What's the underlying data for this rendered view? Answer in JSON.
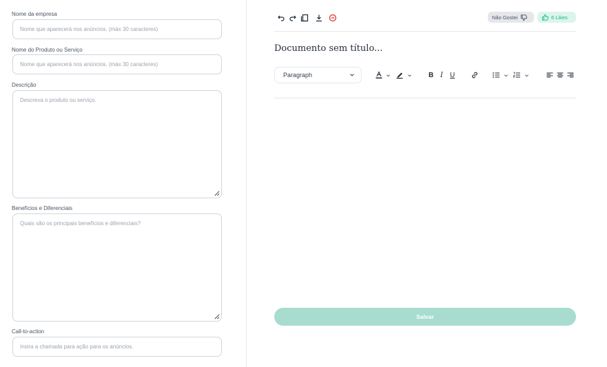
{
  "form": {
    "company_name": {
      "label": "Nome da empresa",
      "placeholder": "Nome que aparecerá nos anúncios. (máx 30 caracteres)"
    },
    "product_name": {
      "label": "Nome do Produto ou Serviço",
      "placeholder": "Nome que aparecerá nos anúncios. (máx 30 caracteres)"
    },
    "description": {
      "label": "Descrição",
      "placeholder": "Descreva o produto ou serviço."
    },
    "benefits": {
      "label": "Benefícios e Diferenciais",
      "placeholder": "Quais são os principais benefícios e diferenciais?"
    },
    "cta": {
      "label": "Call-to-action",
      "placeholder": "Insira a chamada para ação para os anúncios."
    }
  },
  "editor": {
    "feedback": {
      "dislike_label": "Não Gostei",
      "like_label": "6 Likes"
    },
    "document_title": "Documento sem título...",
    "paragraph_select": "Paragraph",
    "save_label": "Salvar",
    "colors": {
      "accent": "#10b981",
      "save_bg": "#a7dccf",
      "like_bg": "#dcf5ec",
      "danger": "#dc2626"
    }
  }
}
